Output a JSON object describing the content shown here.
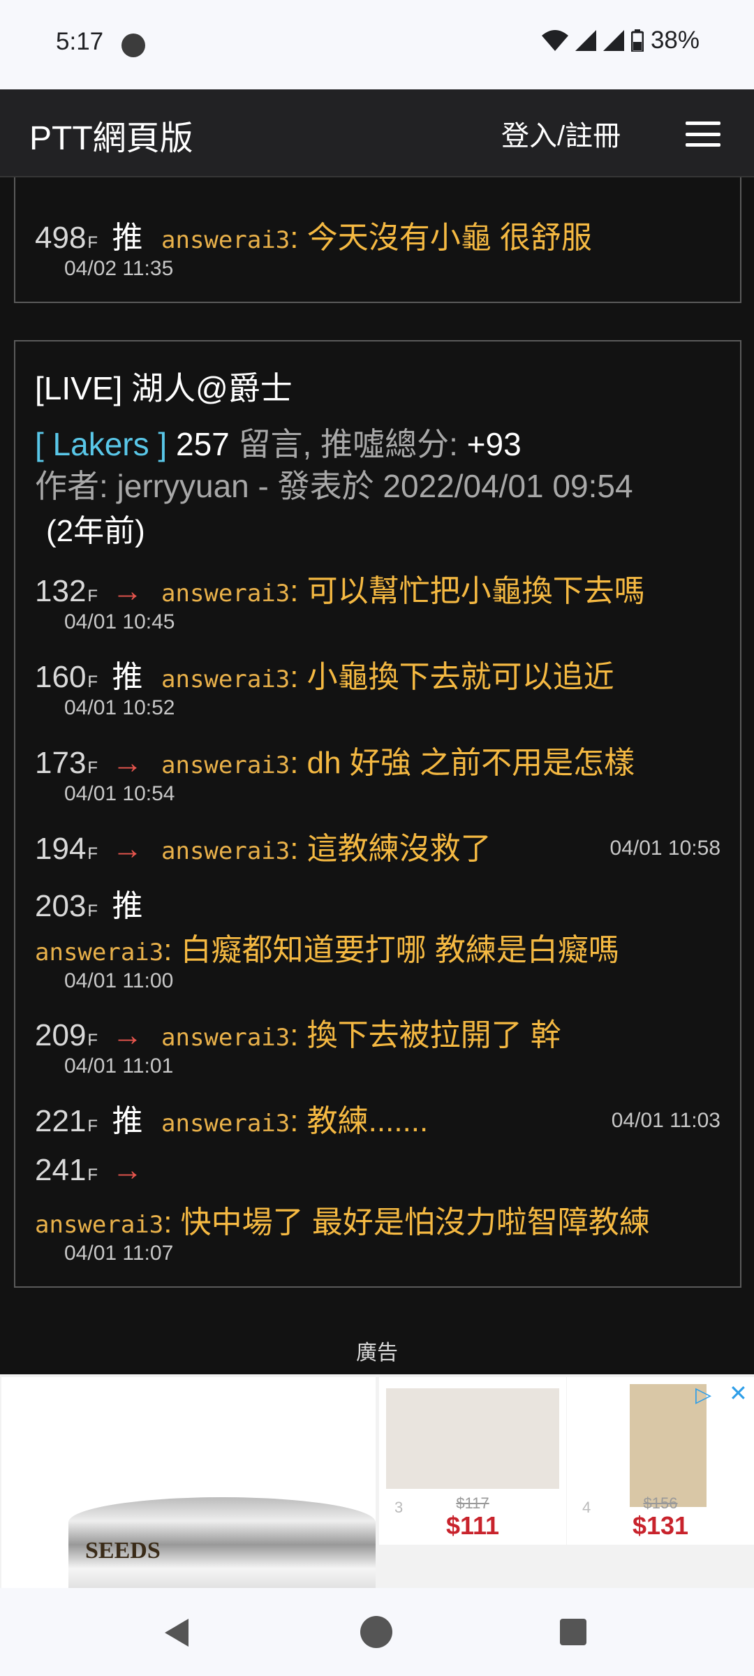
{
  "status": {
    "time": "5:17",
    "battery": "38%"
  },
  "header": {
    "title": "PTT網頁版",
    "login": "登入/註冊"
  },
  "prev_post": {
    "cutoff_text": "(2年前)",
    "comment": {
      "floor": "498",
      "floor_suffix": "F",
      "tag": "推",
      "user": "answerai3",
      "sep": ":",
      "text": " 今天沒有小龜 很舒服",
      "time": "04/02 11:35"
    }
  },
  "post": {
    "title": "[LIVE] 湖人@爵士",
    "board": "[ Lakers ]",
    "count": "257",
    "count_label": "留言, 推噓總分:",
    "score": "+93",
    "author_line": "作者: jerryyuan - 發表於 2022/04/01 09:54",
    "ago": "(2年前)",
    "comments": [
      {
        "floor": "132",
        "f": "F",
        "tag": "→",
        "user": "answerai3",
        "text": ": 可以幫忙把小龜換下去嗎",
        "time": "04/01 10:45"
      },
      {
        "floor": "160",
        "f": "F",
        "tag": "推",
        "user": "answerai3",
        "text": ": 小龜換下去就可以追近",
        "time": "04/01 10:52"
      },
      {
        "floor": "173",
        "f": "F",
        "tag": "→",
        "user": "answerai3",
        "text": ": dh 好強 之前不用是怎樣",
        "time": "04/01 10:54"
      },
      {
        "floor": "194",
        "f": "F",
        "tag": "→",
        "user": "answerai3",
        "text": ": 這教練沒救了",
        "time": "04/01 10:58"
      },
      {
        "floor": "203",
        "f": "F",
        "tag": "推",
        "user": "answerai3",
        "text": ": 白癡都知道要打哪 教練是白癡嗎",
        "time": "04/01 11:00"
      },
      {
        "floor": "209",
        "f": "F",
        "tag": "→",
        "user": "answerai3",
        "text": ": 換下去被拉開了 幹",
        "time": "04/01 11:01"
      },
      {
        "floor": "221",
        "f": "F",
        "tag": "推",
        "user": "answerai3",
        "text": ": 教練.......",
        "time": "04/01 11:03"
      },
      {
        "floor": "241",
        "f": "F",
        "tag": "→",
        "user": "answerai3",
        "text": ": 快中場了 最好是怕沒力啦智障教練",
        "time": "04/01 11:07"
      }
    ]
  },
  "ad": {
    "label": "廣告",
    "main_brand": "SEEDS",
    "products": [
      {
        "idx": "3",
        "old": "$117",
        "new": "$111"
      },
      {
        "idx": "4",
        "old": "$156",
        "new": "$131"
      }
    ]
  }
}
